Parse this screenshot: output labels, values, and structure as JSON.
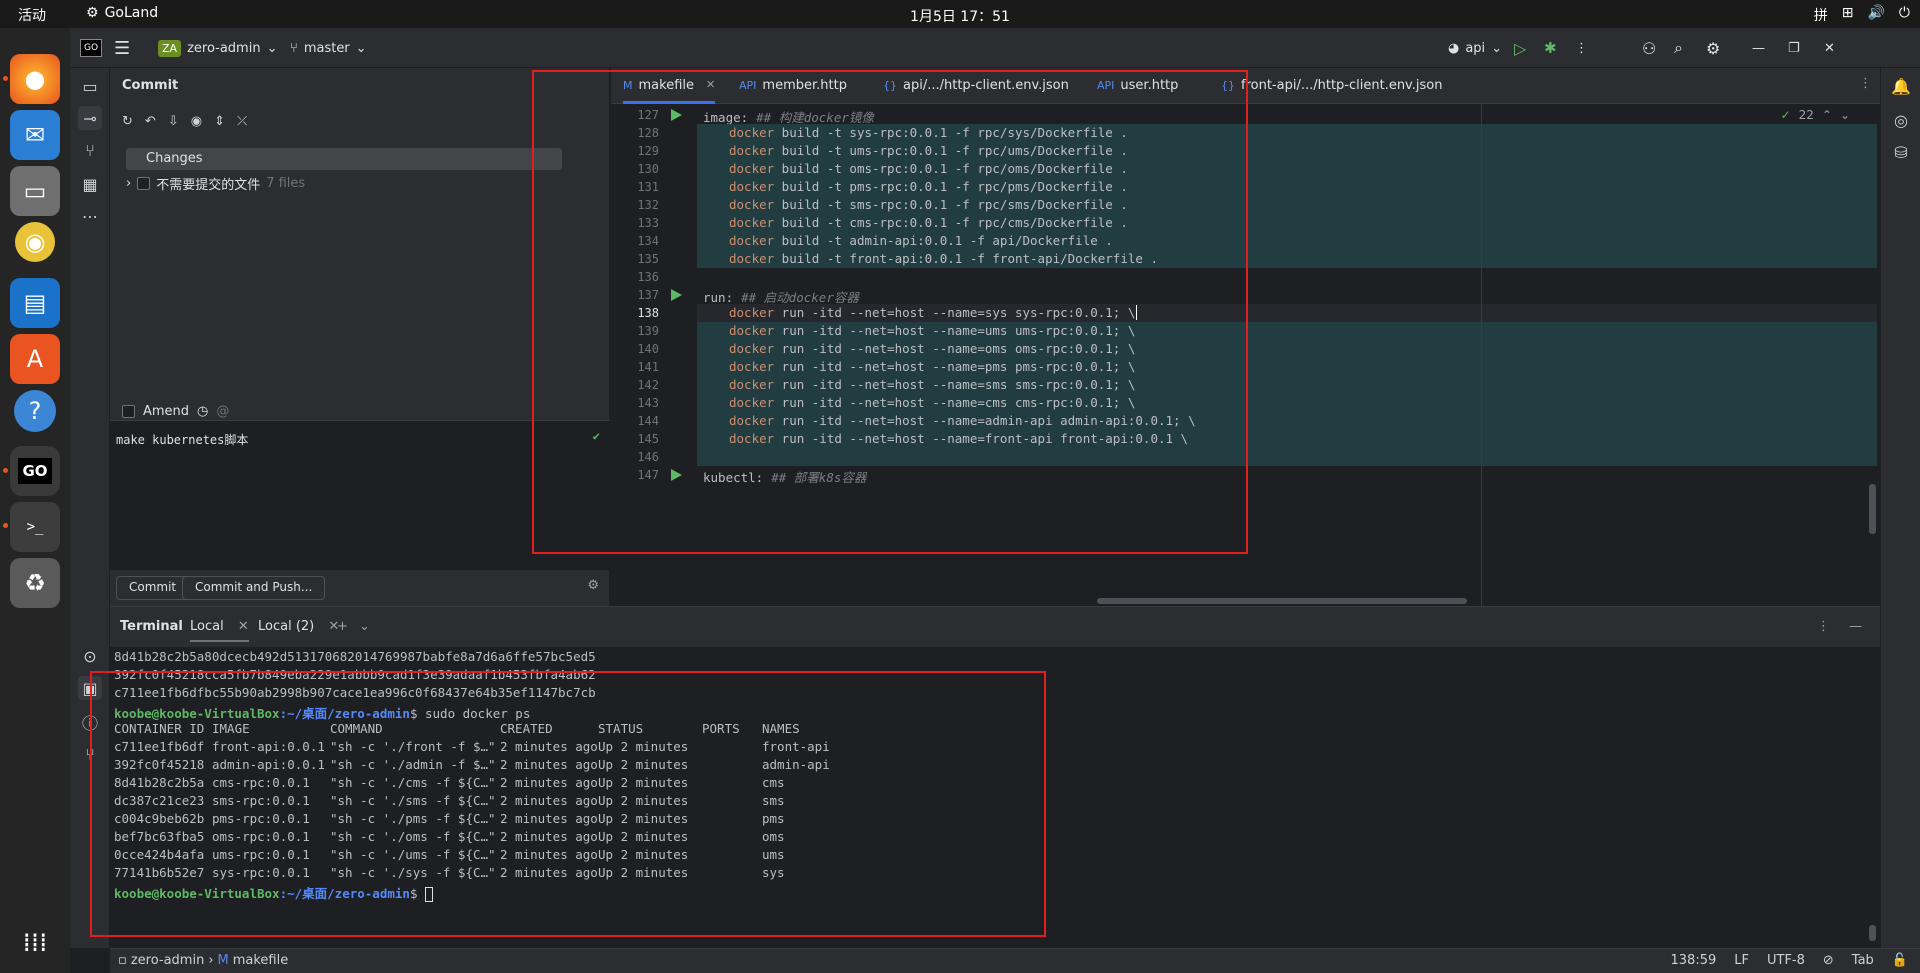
{
  "topbar": {
    "activities": "活动",
    "app_name": "GoLand",
    "clock": "1月5日  17：51",
    "ime": "拼"
  },
  "dock": {
    "items": [
      "firefox-icon",
      "thunderbird-icon",
      "files-icon",
      "rhythmbox-icon",
      "writer-icon",
      "software-icon",
      "help-icon",
      "goland-icon",
      "terminal-icon",
      "trash-icon",
      "apps-grid-icon"
    ]
  },
  "toolbar": {
    "project_badge": "ZA",
    "project": "zero-admin",
    "branch": "master",
    "run_config": "api"
  },
  "commit": {
    "title": "Commit",
    "changes_label": "Changes",
    "nofiles_label": "不需要提交的文件",
    "nofiles_count": "7 files",
    "amend_label": "Amend",
    "message": "make kubernetes脚本",
    "commit_button": "Commit",
    "commit_push_button": "Commit and Push..."
  },
  "tabs": [
    {
      "label": "makefile",
      "icon": "M"
    },
    {
      "label": "member.http",
      "icon": "API"
    },
    {
      "label": "api/.../http-client.env.json",
      "icon": "{}"
    },
    {
      "label": "user.http",
      "icon": "API"
    },
    {
      "label": "front-api/.../http-client.env.json",
      "icon": "{}"
    }
  ],
  "editor": {
    "check_count": "22",
    "lines": [
      {
        "n": "127",
        "target": "image:",
        "comment": "## 构建docker镜像"
      },
      {
        "n": "128",
        "cmd": "docker",
        "rest": " build -t sys-rpc:0.0.1 -f rpc/sys/Dockerfile ."
      },
      {
        "n": "129",
        "cmd": "docker",
        "rest": " build -t ums-rpc:0.0.1 -f rpc/ums/Dockerfile ."
      },
      {
        "n": "130",
        "cmd": "docker",
        "rest": " build -t oms-rpc:0.0.1 -f rpc/oms/Dockerfile ."
      },
      {
        "n": "131",
        "cmd": "docker",
        "rest": " build -t pms-rpc:0.0.1 -f rpc/pms/Dockerfile ."
      },
      {
        "n": "132",
        "cmd": "docker",
        "rest": " build -t sms-rpc:0.0.1 -f rpc/sms/Dockerfile ."
      },
      {
        "n": "133",
        "cmd": "docker",
        "rest": " build -t cms-rpc:0.0.1 -f rpc/cms/Dockerfile ."
      },
      {
        "n": "134",
        "cmd": "docker",
        "rest": " build -t admin-api:0.0.1 -f api/Dockerfile ."
      },
      {
        "n": "135",
        "cmd": "docker",
        "rest": " build -t front-api:0.0.1 -f front-api/Dockerfile ."
      },
      {
        "n": "136"
      },
      {
        "n": "137",
        "target": "run:",
        "comment": "## 启动docker容器"
      },
      {
        "n": "138",
        "cmd": "docker",
        "rest": " run -itd --net=host --name=sys sys-rpc:0.0.1; \\"
      },
      {
        "n": "139",
        "cmd": "docker",
        "rest": " run -itd --net=host --name=ums ums-rpc:0.0.1; \\"
      },
      {
        "n": "140",
        "cmd": "docker",
        "rest": " run -itd --net=host --name=oms oms-rpc:0.0.1; \\"
      },
      {
        "n": "141",
        "cmd": "docker",
        "rest": " run -itd --net=host --name=pms pms-rpc:0.0.1; \\"
      },
      {
        "n": "142",
        "cmd": "docker",
        "rest": " run -itd --net=host --name=sms sms-rpc:0.0.1; \\"
      },
      {
        "n": "143",
        "cmd": "docker",
        "rest": " run -itd --net=host --name=cms cms-rpc:0.0.1; \\"
      },
      {
        "n": "144",
        "cmd": "docker",
        "rest": " run -itd --net=host --name=admin-api admin-api:0.0.1; \\"
      },
      {
        "n": "145",
        "cmd": "docker",
        "rest": " run -itd --net=host --name=front-api front-api:0.0.1 \\"
      },
      {
        "n": "146"
      },
      {
        "n": "147",
        "target": "kubectl:",
        "comment": "## 部署k8s容器"
      }
    ]
  },
  "terminal": {
    "title": "Terminal",
    "tabs": [
      "Local",
      "Local (2)"
    ],
    "hash_lines": [
      "8d41b28c2b5a80dcecb492d513170682014769987babfe8a7d6a6ffe57bc5ed5",
      "392fc0f45218cca5fb7b849eba229e1abbb9cad1f3e39adaaf1b453fbfa4ab62",
      "c711ee1fb6dfbc55b90ab2998b907cace1ea996c0f68437e64b35ef1147bc7cb"
    ],
    "prompt_user": "koobe@koobe-VirtualBox",
    "prompt_path_pre": ":~/",
    "prompt_path": "桌面/zero-admin",
    "command": "$ sudo docker ps",
    "prompt_end": "$ ",
    "headers": [
      "CONTAINER ID",
      "IMAGE",
      "COMMAND",
      "CREATED",
      "STATUS",
      "PORTS",
      "NAMES"
    ],
    "rows": [
      [
        "c711ee1fb6df",
        "front-api:0.0.1",
        "\"sh -c './front -f $…\"",
        "2 minutes ago",
        "Up 2 minutes",
        "",
        "front-api"
      ],
      [
        "392fc0f45218",
        "admin-api:0.0.1",
        "\"sh -c './admin -f $…\"",
        "2 minutes ago",
        "Up 2 minutes",
        "",
        "admin-api"
      ],
      [
        "8d41b28c2b5a",
        "cms-rpc:0.0.1",
        "\"sh -c './cms -f ${C…\"",
        "2 minutes ago",
        "Up 2 minutes",
        "",
        "cms"
      ],
      [
        "dc387c21ce23",
        "sms-rpc:0.0.1",
        "\"sh -c './sms -f ${C…\"",
        "2 minutes ago",
        "Up 2 minutes",
        "",
        "sms"
      ],
      [
        "c004c9beb62b",
        "pms-rpc:0.0.1",
        "\"sh -c './pms -f ${C…\"",
        "2 minutes ago",
        "Up 2 minutes",
        "",
        "pms"
      ],
      [
        "bef7bc63fba5",
        "oms-rpc:0.0.1",
        "\"sh -c './oms -f ${C…\"",
        "2 minutes ago",
        "Up 2 minutes",
        "",
        "oms"
      ],
      [
        "0cce424b4afa",
        "ums-rpc:0.0.1",
        "\"sh -c './ums -f ${C…\"",
        "2 minutes ago",
        "Up 2 minutes",
        "",
        "ums"
      ],
      [
        "77141b6b52e7",
        "sys-rpc:0.0.1",
        "\"sh -c './sys -f ${C…\"",
        "2 minutes ago",
        "Up 2 minutes",
        "",
        "sys"
      ]
    ]
  },
  "status": {
    "project": "zero-admin",
    "file": "makefile",
    "position": "138:59",
    "line_sep": "LF",
    "encoding": "UTF-8",
    "indent": "Tab"
  },
  "colors": {
    "accent": "#3574f0",
    "run_green": "#5fb865",
    "highlight": "#e02020"
  }
}
